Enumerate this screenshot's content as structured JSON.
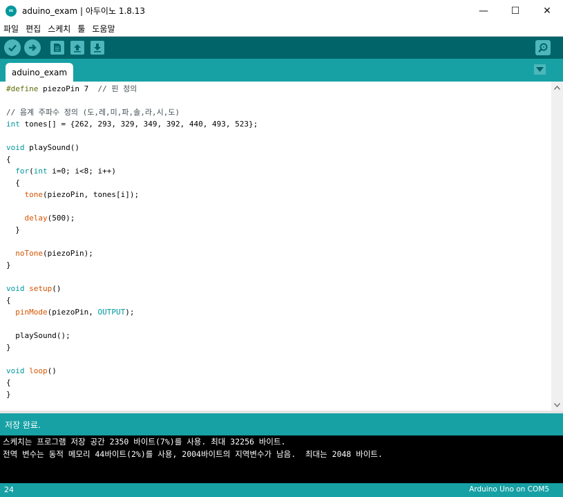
{
  "window": {
    "title": "aduino_exam | 아두이노 1.8.13",
    "minimize": "—",
    "maximize": "☐",
    "close": "✕"
  },
  "menu": [
    "파일",
    "편집",
    "스케치",
    "툴",
    "도움말"
  ],
  "toolbar": {
    "verify_icon": "checkmark-icon",
    "upload_icon": "arrow-right-icon",
    "new_icon": "document-icon",
    "open_icon": "upload-arrow-icon",
    "save_icon": "download-arrow-icon",
    "serial_icon": "magnifier-icon"
  },
  "tab": {
    "label": "aduino_exam"
  },
  "code": [
    "#define piezoPin 7  // 핀 정의",
    "",
    "// 음계 주파수 정의 (도,레,미,파,솔,라,시,도)",
    "int tones[] = {262, 293, 329, 349, 392, 440, 493, 523};",
    "",
    "void playSound()",
    "{",
    "  for(int i=0; i<8; i++)",
    "  {",
    "    tone(piezoPin, tones[i]);",
    "",
    "    delay(500);",
    "  }",
    "",
    "  noTone(piezoPin);",
    "}",
    "",
    "void setup()",
    "{",
    "  pinMode(piezoPin, OUTPUT);",
    "",
    "  playSound();",
    "}",
    "",
    "void loop()",
    "{",
    "}"
  ],
  "status": {
    "message": "저장 완료."
  },
  "console": [
    "스케치는 프로그램 저장 공간 2350 바이트(7%)를 사용. 최대 32256 바이트.",
    "전역 변수는 동적 메모리 44바이트(2%)를 사용, 2004바이트의 지역변수가 남음.  최대는 2048 바이트."
  ],
  "footer": {
    "line": "24",
    "board": "Arduino Uno on COM5"
  },
  "colors": {
    "toolbar": "#006468",
    "tabbar": "#17a1a5",
    "keyword": "#00979c",
    "function": "#d35400"
  }
}
